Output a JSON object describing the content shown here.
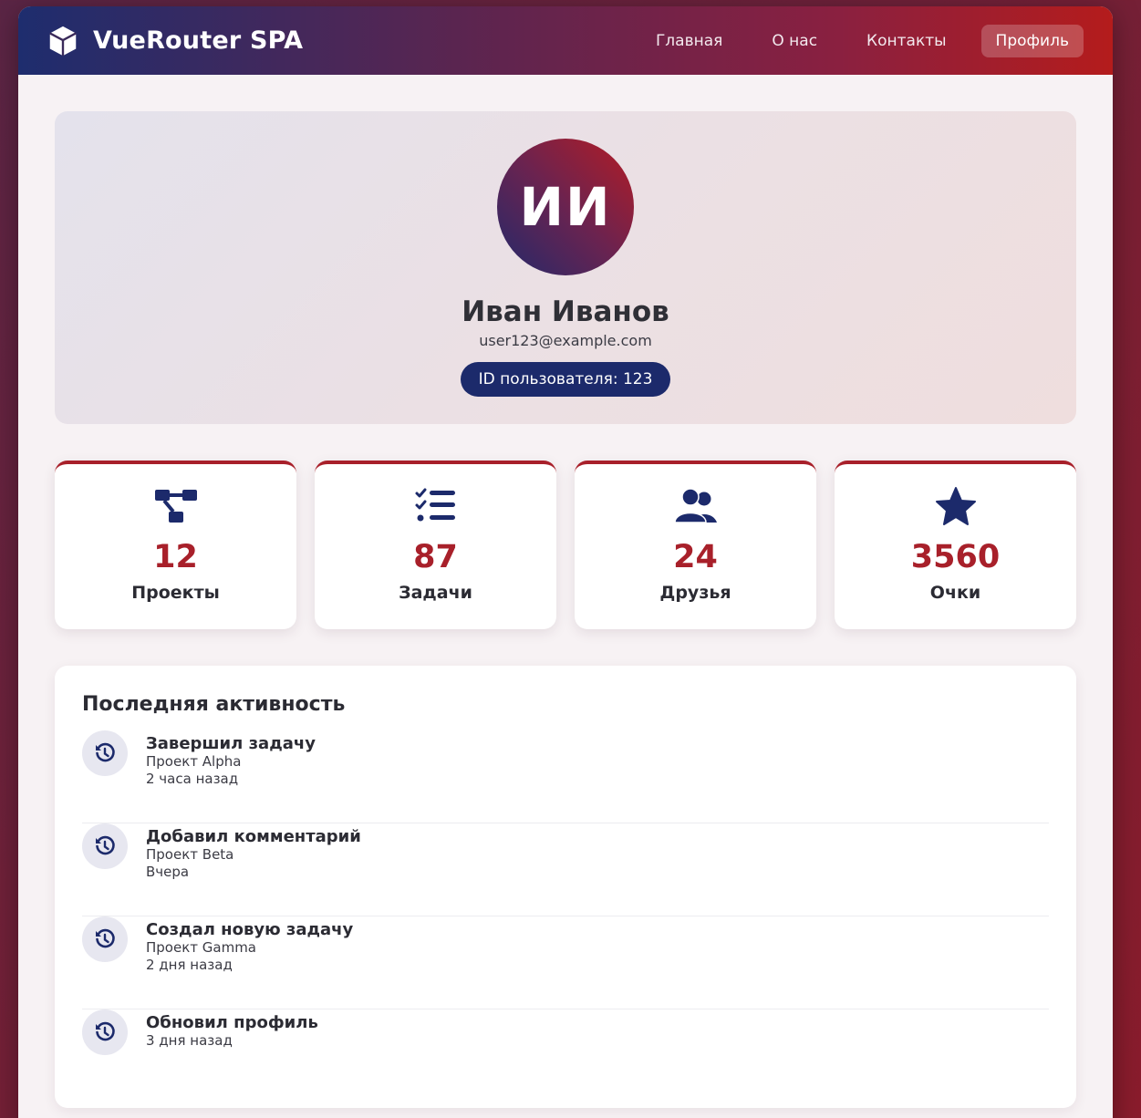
{
  "navbar": {
    "brand": "VueRouter SPA",
    "links": [
      "Главная",
      "О нас",
      "Контакты",
      "Профиль"
    ],
    "active_index": 3
  },
  "profile": {
    "initials": "ИИ",
    "name": "Иван Иванов",
    "email": "user123@example.com",
    "id_label": "ID пользователя: 123"
  },
  "stats": [
    {
      "icon": "project-diagram-icon",
      "value": "12",
      "label": "Проекты"
    },
    {
      "icon": "tasks-icon",
      "value": "87",
      "label": "Задачи"
    },
    {
      "icon": "users-icon",
      "value": "24",
      "label": "Друзья"
    },
    {
      "icon": "star-icon",
      "value": "3560",
      "label": "Очки"
    }
  ],
  "activity": {
    "title": "Последняя активность",
    "items": [
      {
        "icon": "history-icon",
        "action": "Завершил задачу",
        "project": "Проект Alpha",
        "time": "2 часа назад"
      },
      {
        "icon": "history-icon",
        "action": "Добавил комментарий",
        "project": "Проект Beta",
        "time": "Вчера"
      },
      {
        "icon": "history-icon",
        "action": "Создал новую задачу",
        "project": "Проект Gamma",
        "time": "2 дня назад"
      },
      {
        "icon": "history-icon",
        "action": "Обновил профиль",
        "project": "",
        "time": "3 дня назад"
      }
    ]
  },
  "colors": {
    "accent": "#a8202a",
    "navy": "#1c2a6b",
    "background": "#7a1f33"
  }
}
